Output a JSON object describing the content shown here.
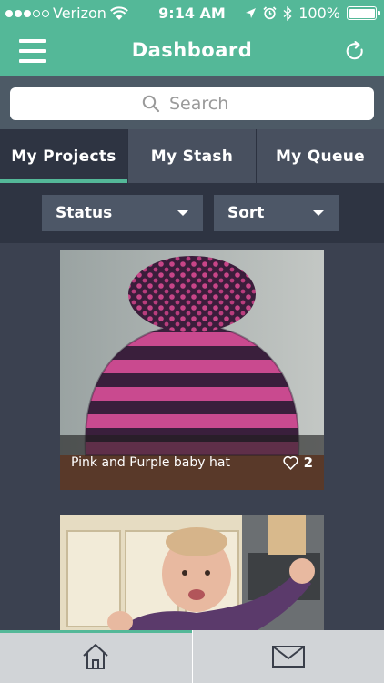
{
  "status_bar": {
    "carrier": "Verizon",
    "time": "9:14 AM",
    "battery": "100%",
    "signal_bars_filled": 3,
    "signal_bars_total": 5
  },
  "header": {
    "title": "Dashboard",
    "menu_icon": "hamburger-menu-icon",
    "refresh_icon": "refresh-icon"
  },
  "search": {
    "placeholder": "Search",
    "value": ""
  },
  "tabs": [
    {
      "label": "My Projects",
      "active": true
    },
    {
      "label": "My Stash",
      "active": false
    },
    {
      "label": "My Queue",
      "active": false
    }
  ],
  "filters": {
    "status_label": "Status",
    "sort_label": "Sort"
  },
  "projects": [
    {
      "title": "Pink and Purple baby hat",
      "likes": "2"
    }
  ],
  "bottom_nav": {
    "home_icon": "home-icon",
    "messages_icon": "envelope-icon",
    "active": "home"
  },
  "colors": {
    "accent": "#54b898",
    "background": "#3b4150",
    "tab_bar": "#48505f",
    "active_tab": "#2e3442"
  }
}
